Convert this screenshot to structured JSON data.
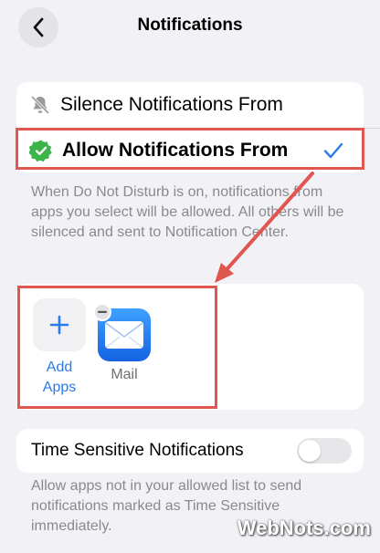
{
  "header": {
    "title": "Notifications",
    "back_icon": "chevron-left-icon"
  },
  "options": {
    "silence_label": "Silence Notifications From",
    "allow_label": "Allow Notifications From"
  },
  "description": "When Do Not Disturb is on, notifications from apps you select will be allowed. All others will be silenced and sent to Notification Center.",
  "apps": {
    "add_label_line1": "Add",
    "add_label_line2": "Apps",
    "items": [
      {
        "label": "Mail"
      }
    ]
  },
  "time_sensitive": {
    "label": "Time Sensitive Notifications",
    "enabled": false,
    "footnote": "Allow apps not in your allowed list to send notifications marked as Time Sensitive immediately."
  },
  "watermark": "WebNots.com",
  "colors": {
    "accent": "#2a7be8",
    "highlight": "#e0574f"
  }
}
